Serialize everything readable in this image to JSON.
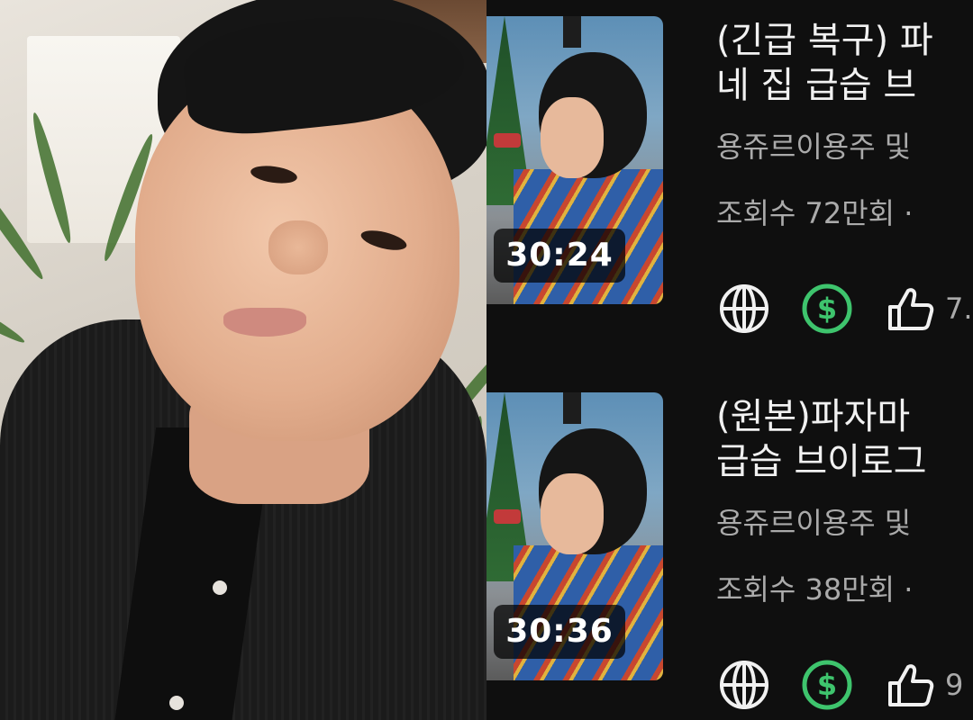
{
  "videos": [
    {
      "title_line1": "(긴급 복구) 파",
      "title_line2": "네 집 급습 브",
      "channel": "용쥬르이용주 및",
      "views": "조회수 72만회 ·",
      "duration": "30:24",
      "like_count": "7.",
      "icons": [
        "globe-icon",
        "dollar-icon",
        "thumbs-up-icon"
      ]
    },
    {
      "title_line1": "(원본)파자마",
      "title_line2": "급습 브이로그",
      "channel": "용쥬르이용주 및",
      "views": "조회수 38만회 ·",
      "duration": "30:36",
      "like_count": "9",
      "icons": [
        "globe-icon",
        "dollar-icon",
        "thumbs-up-icon"
      ]
    }
  ],
  "colors": {
    "background": "#0f0f0f",
    "title": "#f1f1f1",
    "secondary": "#aaaaaa",
    "dollar": "#3ec46d"
  }
}
